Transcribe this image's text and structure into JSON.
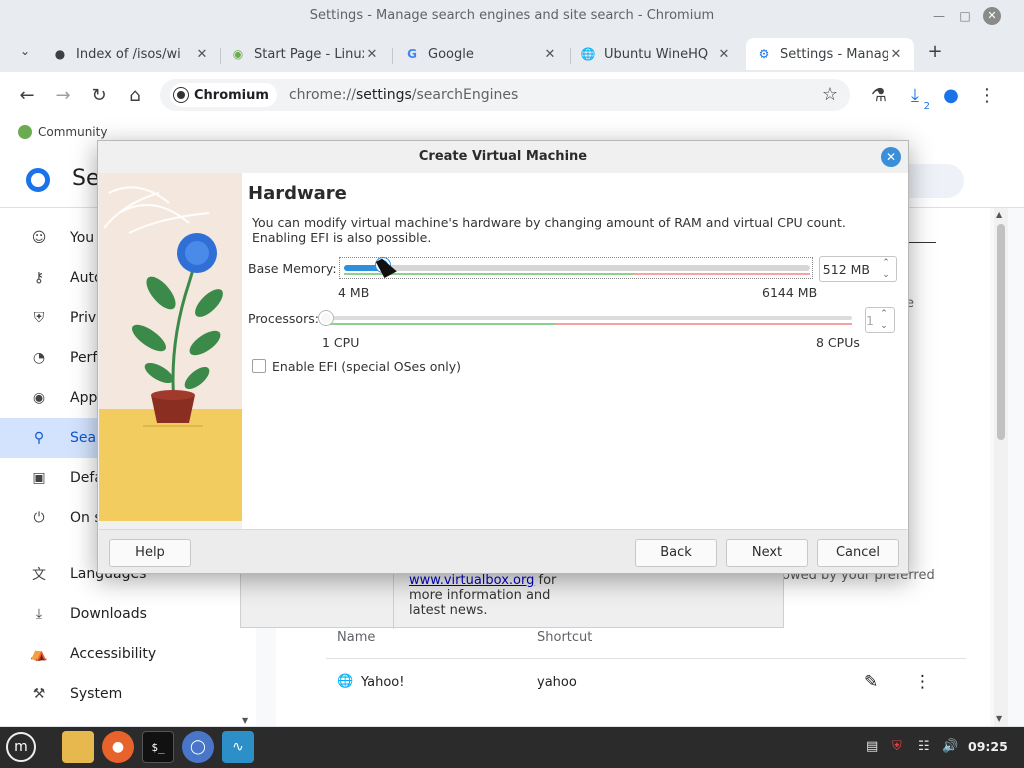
{
  "window": {
    "title": "Settings - Manage search engines and site search - Chromium"
  },
  "tabs": [
    {
      "title": "Index of /isos/wi",
      "icon": "page-icon"
    },
    {
      "title": "Start Page - Linux",
      "icon": "mint-icon"
    },
    {
      "title": "Google",
      "icon": "google-icon"
    },
    {
      "title": "Ubuntu WineHQ",
      "icon": "globe-icon"
    },
    {
      "title": "Settings - Manag",
      "icon": "gear-icon"
    }
  ],
  "toolbar": {
    "site_chip": "Chromium",
    "url_prefix": "chrome://",
    "url_host": "settings",
    "url_path": "/searchEngines",
    "downloads_badge": "2"
  },
  "bookmarks": [
    {
      "label": "Community"
    }
  ],
  "settings": {
    "header_title": "Se",
    "nav": [
      {
        "label": "You",
        "icon": "person-icon"
      },
      {
        "label": "Auto",
        "icon": "key-icon"
      },
      {
        "label": "Priva",
        "icon": "shield-icon"
      },
      {
        "label": "Perf",
        "icon": "gauge-icon"
      },
      {
        "label": "Appe",
        "icon": "palette-icon"
      },
      {
        "label": "Sear",
        "icon": "search-icon"
      },
      {
        "label": "Defa",
        "icon": "browser-icon"
      },
      {
        "label": "On s",
        "icon": "power-icon"
      },
      {
        "label": "Languages",
        "icon": "translate-icon"
      },
      {
        "label": "Downloads",
        "icon": "download-icon"
      },
      {
        "label": "Accessibility",
        "icon": "accessibility-icon"
      },
      {
        "label": "System",
        "icon": "wrench-icon"
      }
    ],
    "table": {
      "col_name": "Name",
      "col_shortcut": "Shortcut",
      "rows": [
        {
          "name": "Yahoo!",
          "shortcut": "yahoo"
        }
      ]
    },
    "partial_text_1": "e",
    "partial_text_2": "owed by your preferred"
  },
  "vbox_behind": {
    "link": "www.virtualbox.org",
    "text_1": " for",
    "text_2": "more information and",
    "text_3": "latest news."
  },
  "dialog": {
    "title": "Create Virtual Machine",
    "heading": "Hardware",
    "description_1": "You can modify virtual machine's hardware by changing amount of RAM and virtual CPU count.",
    "description_2": "Enabling EFI is also possible.",
    "memory": {
      "label": "Base Memory:",
      "value": "512 MB",
      "min_label": "4 MB",
      "max_label": "6144 MB",
      "min": 4,
      "max": 6144,
      "current": 512
    },
    "processors": {
      "label": "Processors:",
      "value": "1",
      "min_label": "1 CPU",
      "max_label": "8 CPUs",
      "min": 1,
      "max": 8,
      "current": 1
    },
    "efi": {
      "label": "Enable EFI (special OSes only)",
      "checked": false
    },
    "buttons": {
      "help": "Help",
      "back": "Back",
      "next": "Next",
      "cancel": "Cancel"
    }
  },
  "taskbar": {
    "clock": "09:25"
  },
  "colors": {
    "accent": "#2f8fdc",
    "safe_zone": "#7fcf7f",
    "warn_zone": "#f4a0a0"
  }
}
